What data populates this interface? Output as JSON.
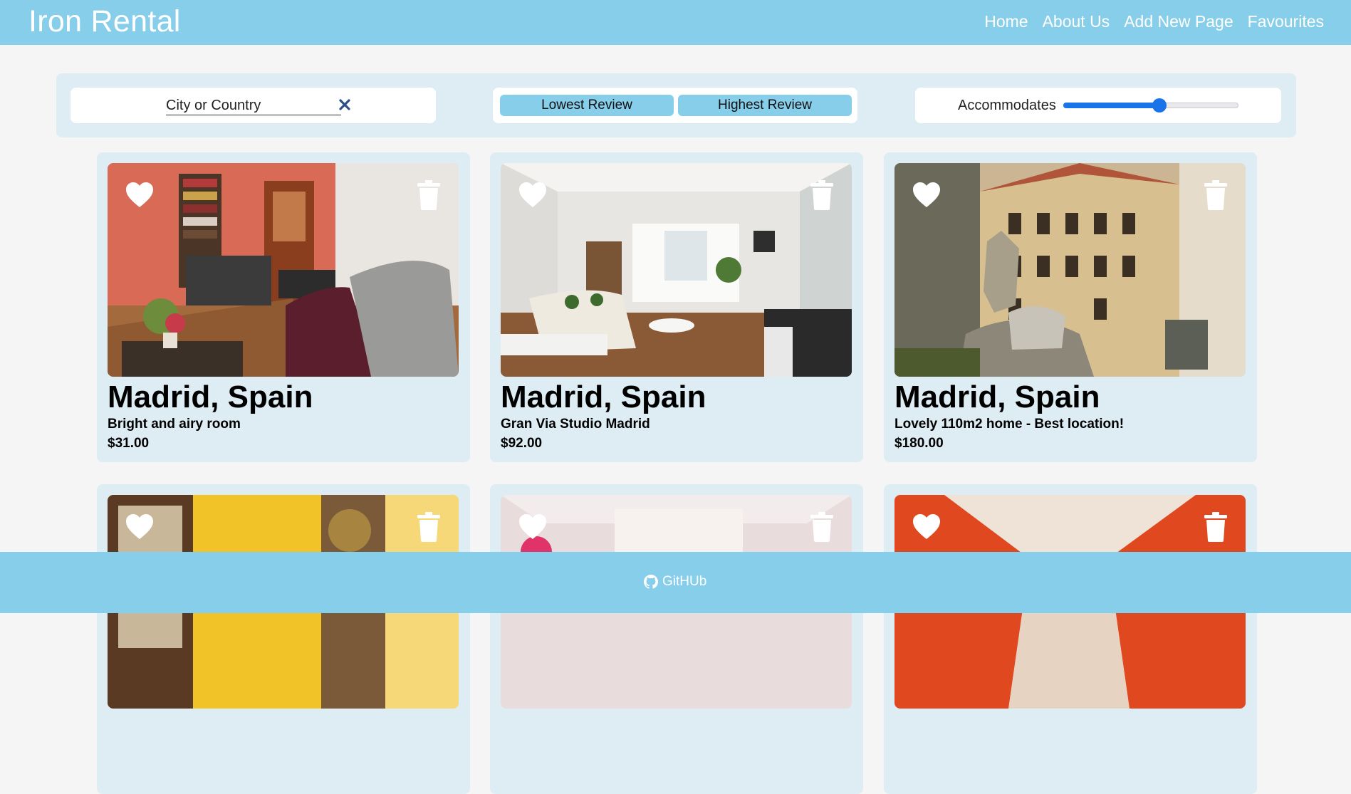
{
  "navbar": {
    "brand": "Iron Rental",
    "links": [
      "Home",
      "About Us",
      "Add New Page",
      "Favourites"
    ]
  },
  "filters": {
    "search_placeholder": "City or Country",
    "sort_lowest": "Lowest Review",
    "sort_highest": "Highest Review",
    "accommodates_label": "Accommodates",
    "accommodates_level": 0.55
  },
  "listings": [
    {
      "city": "Madrid, Spain",
      "name": "Bright and airy room",
      "price": "$31.00"
    },
    {
      "city": "Madrid, Spain",
      "name": "Gran Via Studio Madrid",
      "price": "$92.00"
    },
    {
      "city": "Madrid, Spain",
      "name": "Lovely 110m2 home - Best location!",
      "price": "$180.00"
    },
    {
      "city": "",
      "name": "",
      "price": ""
    },
    {
      "city": "",
      "name": "",
      "price": ""
    },
    {
      "city": "",
      "name": "",
      "price": ""
    }
  ],
  "footer": {
    "github_label": "GitHUb"
  },
  "colors": {
    "navbar": "#87ceeb",
    "panel": "#deedf4",
    "slider": "#1a73e8"
  }
}
